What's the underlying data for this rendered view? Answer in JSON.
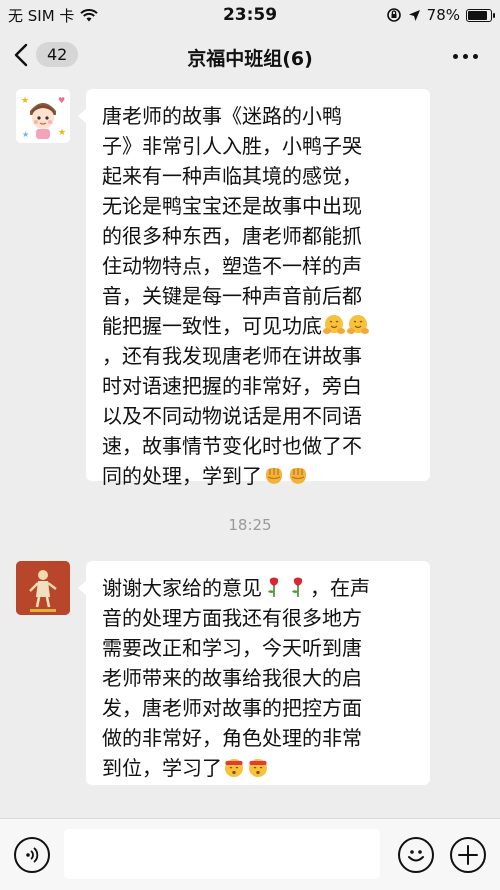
{
  "status_bar": {
    "carrier": "无 SIM 卡",
    "time": "23:59",
    "battery_text": "78%",
    "battery_level": 0.78
  },
  "nav": {
    "unread_count": "42",
    "title": "京福中班组(6)"
  },
  "messages": [
    {
      "avatar": "cartoon-child-avatar",
      "lines": [
        "唐老师的故事《迷路的小鸭",
        "子》非常引人入胜，小鸭子哭",
        "起来有一种声临其境的感觉，",
        "无论是鸭宝宝还是故事中出现",
        "的很多种东西，唐老师都能抓",
        "住动物特点，塑造不一样的声",
        "音，关键是每一种声音前后都",
        "能把握一致性，可见功底",
        "，还有我发现唐老师在讲故事",
        "时对语速把握的非常好，旁白",
        "以及不同动物说话是用不同语",
        "速，故事情节变化时也做了不",
        "同的处理，学到了"
      ]
    },
    {
      "avatar": "red-illustration-avatar",
      "lines": [
        "谢谢大家给的意见",
        "，在声",
        "音的处理方面我还有很多地方",
        "需要改正和学习，今天听到唐",
        "老师带来的故事给我很大的启",
        "发，唐老师对故事的把控方面",
        "做的非常好，角色处理的非常",
        "到位，学习了"
      ]
    }
  ],
  "timestamp": "18:25",
  "colors": {
    "background": "#ededed",
    "bubble": "#ffffff",
    "timestamp": "#9a9a9a",
    "rose": "#d9262f",
    "emoji_yellow": "#f7c23a"
  }
}
